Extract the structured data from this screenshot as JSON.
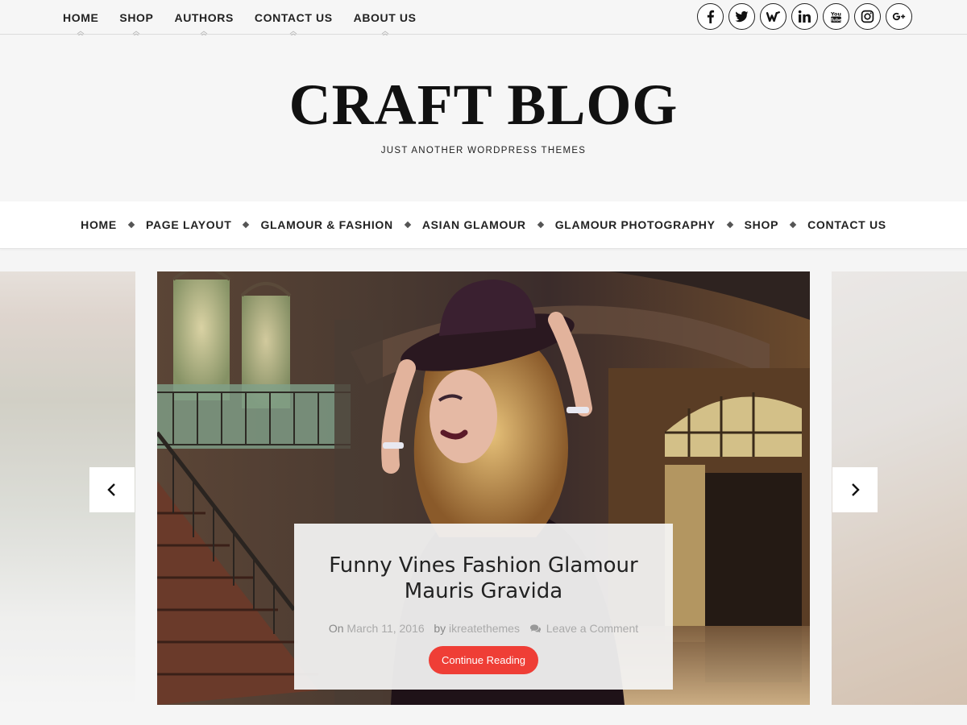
{
  "topnav": {
    "items": [
      {
        "label": "HOME"
      },
      {
        "label": "SHOP"
      },
      {
        "label": "AUTHORS"
      },
      {
        "label": "CONTACT US"
      },
      {
        "label": "ABOUT US"
      }
    ]
  },
  "socials": [
    "facebook-icon",
    "twitter-icon",
    "wattpad-icon",
    "linkedin-icon",
    "youtube-icon",
    "instagram-icon",
    "google-plus-icon"
  ],
  "header": {
    "title": "CRAFT BLOG",
    "tagline": "JUST ANOTHER WORDPRESS THEMES"
  },
  "mainnav": {
    "items": [
      {
        "label": "HOME"
      },
      {
        "label": "PAGE LAYOUT"
      },
      {
        "label": "GLAMOUR & FASHION"
      },
      {
        "label": "ASIAN GLAMOUR"
      },
      {
        "label": "GLAMOUR PHOTOGRAPHY"
      },
      {
        "label": "SHOP"
      },
      {
        "label": "CONTACT US"
      }
    ]
  },
  "slider": {
    "title": "Funny Vines Fashion Glamour Mauris Gravida",
    "on_label": "On",
    "date": "March 11, 2016",
    "by_label": "by",
    "author": "ikreatethemes",
    "comments": "Leave a Comment",
    "button": "Continue Reading"
  },
  "colors": {
    "accent": "#ef3e36",
    "text": "#222222",
    "background": "#f5f5f5"
  }
}
